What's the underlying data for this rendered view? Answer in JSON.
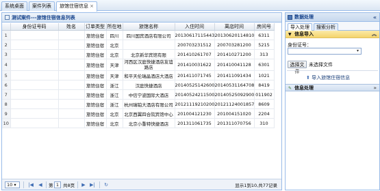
{
  "tabs": [
    {
      "label": "系统桌面"
    },
    {
      "label": "案件列表"
    },
    {
      "label": "旅馆住宿信息",
      "close": "×"
    }
  ],
  "main": {
    "title": "测试案件---旅馆住宿信息列表",
    "columns": [
      "",
      "身份证号码",
      "姓名",
      "订单类型",
      "所在地",
      "旅馆名称",
      "入住时间",
      "离店时间",
      "房间号"
    ],
    "rows": [
      {
        "no": "1",
        "id": "",
        "name": "",
        "type": "旅馆住宿",
        "loc": "四川",
        "hotel": "四川国宾酒店有限公司",
        "in": "20130617115443",
        "out": "20130620114810",
        "room": "6311"
      },
      {
        "no": "2",
        "id": "",
        "name": "",
        "type": "旅馆住宿",
        "loc": "北京",
        "hotel": "",
        "in": "200703231512",
        "out": "200703281200",
        "room": "5215"
      },
      {
        "no": "3",
        "id": "",
        "name": "",
        "type": "旅馆住宿",
        "loc": "北京",
        "hotel": "北京新华宾馆有限",
        "in": "201410261707",
        "out": "201410271200",
        "room": "313"
      },
      {
        "no": "4",
        "id": "",
        "name": "",
        "type": "旅馆住宿",
        "loc": "天津",
        "hotel": "河西区汉庭快捷酒店友谊路店",
        "in": "201410031622",
        "out": "201410041128",
        "room": "6301"
      },
      {
        "no": "5",
        "id": "",
        "name": "",
        "type": "旅馆住宿",
        "loc": "天津",
        "hotel": "和平天伦瑞晶酒店大酒店",
        "in": "201411071745",
        "out": "201411091434",
        "room": "1021"
      },
      {
        "no": "6",
        "id": "",
        "name": "",
        "type": "旅馆住宿",
        "loc": "浙江",
        "hotel": "汉庭快捷酒店",
        "in": "20140525142600",
        "out": "20140531164708",
        "room": "8419"
      },
      {
        "no": "7",
        "id": "",
        "name": "",
        "type": "旅馆住宿",
        "loc": "浙江",
        "hotel": "中信宁波国际大酒店",
        "in": "20140524211500",
        "out": "20140525092900",
        "room": "011902"
      },
      {
        "no": "8",
        "id": "",
        "name": "",
        "type": "旅馆住宿",
        "loc": "浙江",
        "hotel": "杭州瑞铂大酒店有限公司",
        "in": "20121119210200",
        "out": "20121124001857",
        "room": "8609"
      },
      {
        "no": "9",
        "id": "",
        "name": "",
        "type": "旅馆住宿",
        "loc": "北京",
        "hotel": "北京西翼四合院宾馆中心",
        "in": "201004121230",
        "out": "201004151020",
        "room": "2204"
      },
      {
        "no": "10",
        "id": "",
        "name": "",
        "type": "旅馆住宿",
        "loc": "北京",
        "hotel": "北京小重特快捷酒店",
        "in": "201311061735",
        "out": "201311070756",
        "room": "310"
      }
    ]
  },
  "pager": {
    "page_size": "10",
    "first": "|◀",
    "prev": "◀",
    "page_prefix": "第",
    "page": "1",
    "page_suffix": "共8页",
    "next": "▶",
    "last": "▶|",
    "refresh": "↻",
    "summary": "显示1到10,共77记录"
  },
  "right": {
    "title": "数据处理",
    "collapse": "«",
    "subtabs": [
      "导入处理",
      "搜索分析"
    ],
    "import_section": "信息导入",
    "id_label": "身份证号：",
    "choose_file": "选择文件",
    "no_file": "未选择文件",
    "import_link": "导入旅馆住宿信息",
    "process_section": "信息处理",
    "expand": "»"
  }
}
